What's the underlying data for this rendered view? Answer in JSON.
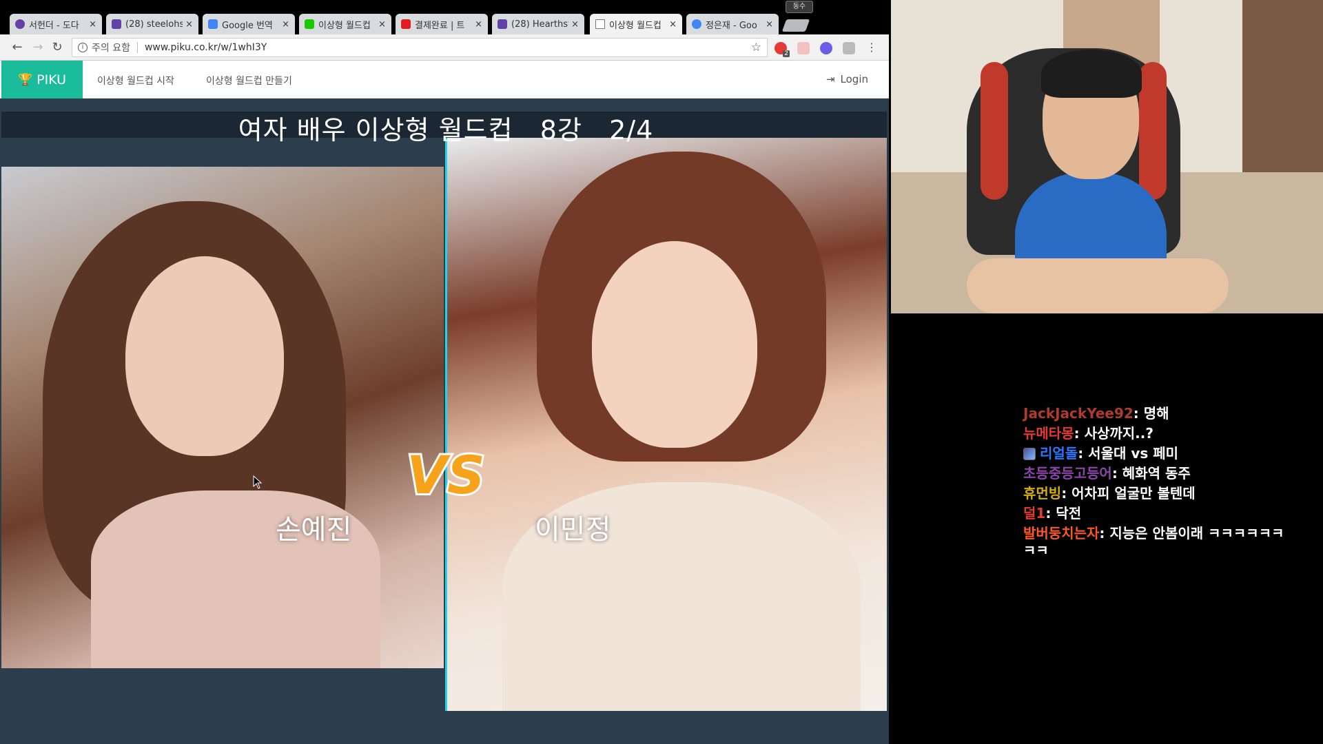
{
  "browser": {
    "tabs": [
      {
        "title": "서헌더 - 도다",
        "icon_color": "#6441a4",
        "active": false
      },
      {
        "title": "(28) steelohs",
        "icon_color": "#6441a4",
        "active": false
      },
      {
        "title": "Google 번역",
        "icon_color": "#4285f4",
        "active": false
      },
      {
        "title": "이상형 월드컵",
        "icon_color": "#1ec800",
        "active": false
      },
      {
        "title": "결제완료 | 트",
        "icon_color": "#e31b23",
        "active": false
      },
      {
        "title": "(28) Hearthst",
        "icon_color": "#6441a4",
        "active": false
      },
      {
        "title": "이상형 월드컵",
        "icon_color": "#9e9e9e",
        "active": true
      },
      {
        "title": "정은재 - Goo",
        "icon_color": "#4285f4",
        "active": false
      }
    ],
    "close_glyph": "×",
    "profile_chip": "동수",
    "address": {
      "security_label": "주의 요함",
      "url": "www.piku.co.kr/w/1whI3Y"
    },
    "extension_badge": "2"
  },
  "site": {
    "brand": "PIKU",
    "nav": [
      "이상형 월드컵 시작",
      "이상형 월드컵 만들기"
    ],
    "login": "Login"
  },
  "worldcup": {
    "title": "여자 배우 이상형 월드컵   8강   2/4",
    "left_name": "손예진",
    "right_name": "이민정",
    "vs_text": "VS"
  },
  "chat": [
    {
      "user": "JackJackYee92",
      "message": "명해",
      "color": "#b03a2e",
      "badge": false
    },
    {
      "user": "뉴메타몽",
      "message": "사상까지..?",
      "color": "#e53935",
      "badge": false
    },
    {
      "user": "리얼돌",
      "message": "서울대 vs 페미",
      "color": "#2979ff",
      "badge": true
    },
    {
      "user": "초등중등고등어",
      "message": "혜화역 동주",
      "color": "#8e44ad",
      "badge": false
    },
    {
      "user": "휴먼빙",
      "message": "어차피 얼굴만 볼텐데",
      "color": "#d4ac0d",
      "badge": false
    },
    {
      "user": "덜1",
      "message": "닥전",
      "color": "#e53935",
      "badge": false
    },
    {
      "user": "발버둥치는자",
      "message": "지능은 안봄이래 ㅋㅋㅋㅋㅋㅋ",
      "color": "#ff5722",
      "badge": false
    },
    {
      "user": "",
      "message": "ㅋㅋ",
      "color": "#ffffff",
      "badge": false
    }
  ]
}
